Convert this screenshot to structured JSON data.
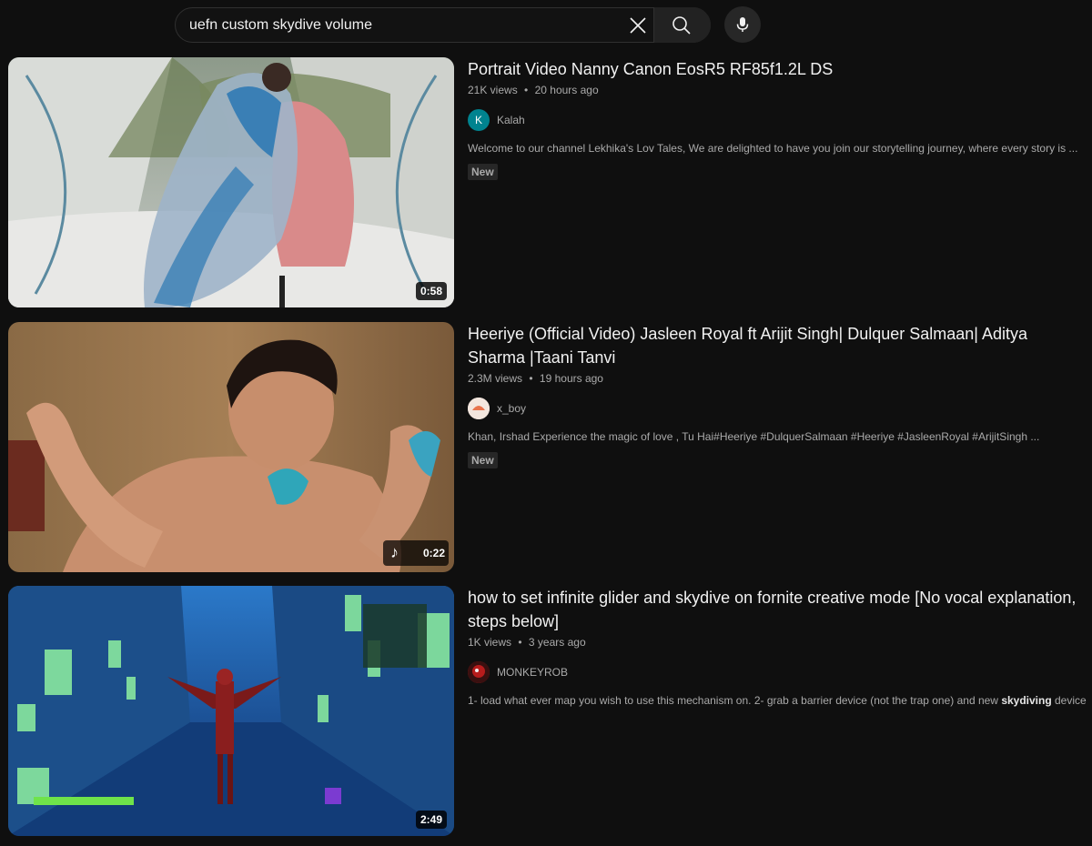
{
  "search": {
    "query": "uefn custom skydive volume",
    "clear_icon": "close-icon",
    "search_icon": "search-icon",
    "mic_icon": "microphone-icon"
  },
  "results": [
    {
      "title": "Portrait Video Nanny Canon EosR5 RF85f1.2L DS",
      "views": "21K views",
      "age": "20 hours ago",
      "channel": "Kalah",
      "avatar_letter": "K",
      "avatar_color": "#00838f",
      "description": "Welcome to our channel Lekhika's Lov Tales, We are delighted to have you join our storytelling journey, where every story is ...",
      "badge": "New",
      "duration": "0:58"
    },
    {
      "title": "Heeriye (Official Video) Jasleen Royal ft Arijit Singh| Dulquer Salmaan| Aditya Sharma |Taani Tanvi",
      "views": "2.3M views",
      "age": "19 hours ago",
      "channel": "x_boy",
      "avatar_color": "#f3e6de",
      "description": "Khan, Irshad Experience the magic of love , Tu Hai#Heeriye #DulquerSalmaan #Heeriye #JasleenRoyal #ArijitSingh ...",
      "badge": "New",
      "duration": "0:22",
      "music_icon": "music-note-icon"
    },
    {
      "title": "how to set infinite glider and skydive on fornite creative mode [No vocal explanation, steps below]",
      "views": "1K views",
      "age": "3 years ago",
      "channel": "MONKEYROB",
      "avatar_color": "#b71c1c",
      "description_before": "1- load what ever map you wish to use this mechanism on. 2- grab a barrier device (not the trap one) and new ",
      "description_bold": "skydiving",
      "description_after": " device ...",
      "duration": "2:49"
    }
  ],
  "separator": "•"
}
